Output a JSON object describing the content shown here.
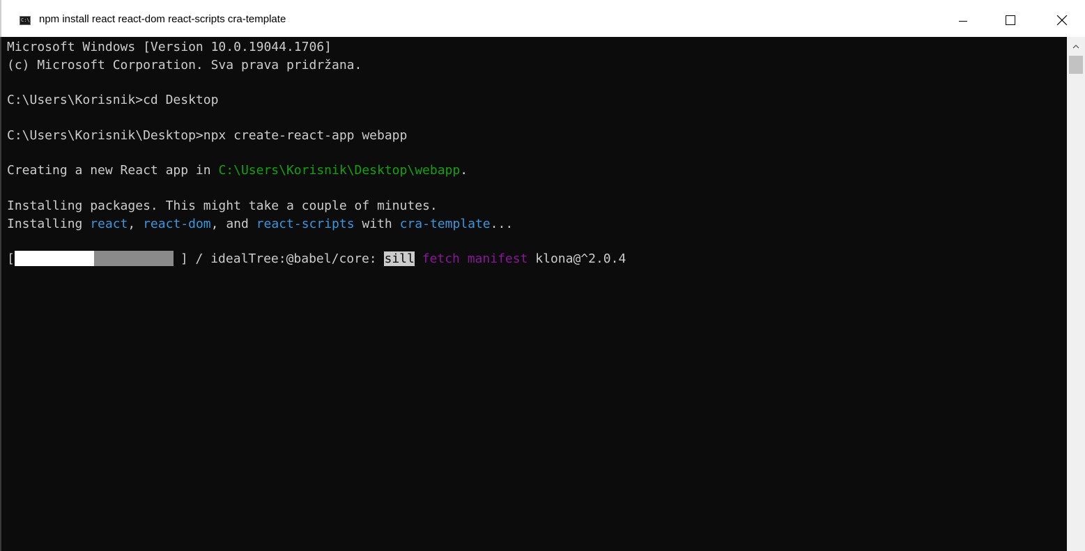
{
  "window": {
    "title": "npm install react react-dom react-scripts cra-template",
    "icon": "cmd-icon",
    "icon_glyph": "C:\\"
  },
  "controls": {
    "minimize": "minimize-icon",
    "maximize": "maximize-icon",
    "close": "close-icon"
  },
  "console": {
    "line1": "Microsoft Windows [Version 10.0.19044.1706]",
    "line2": "(c) Microsoft Corporation. Sva prava pridržana.",
    "line3": "C:\\Users\\Korisnik>cd Desktop",
    "line4": "C:\\Users\\Korisnik\\Desktop>npx create-react-app webapp",
    "creating": {
      "prefix": "Creating a new React app in ",
      "path": "C:\\Users\\Korisnik\\Desktop\\webapp",
      "suffix": "."
    },
    "installing1": "Installing packages. This might take a couple of minutes.",
    "installing2": {
      "prefix": "Installing ",
      "pkg1": "react",
      "sep1": ", ",
      "pkg2": "react-dom",
      "sep2": ", and ",
      "pkg3": "react-scripts",
      "with": " with ",
      "template": "cra-template",
      "suffix": "..."
    },
    "progress": {
      "open_bracket": "[",
      "close_bracket": "]",
      "completed_fraction": 0.48,
      "pending_fraction": 0.48,
      "spinner": "/",
      "stage": "idealTree:@babel/core:",
      "level": "sill",
      "action1": "fetch",
      "action2": "manifest",
      "package": "klona@^2.0.4"
    }
  },
  "colors": {
    "background": "#0c0c0c",
    "foreground": "#cccccc",
    "green": "#13a10e",
    "blue": "#3a96dd",
    "purple": "#881798"
  }
}
